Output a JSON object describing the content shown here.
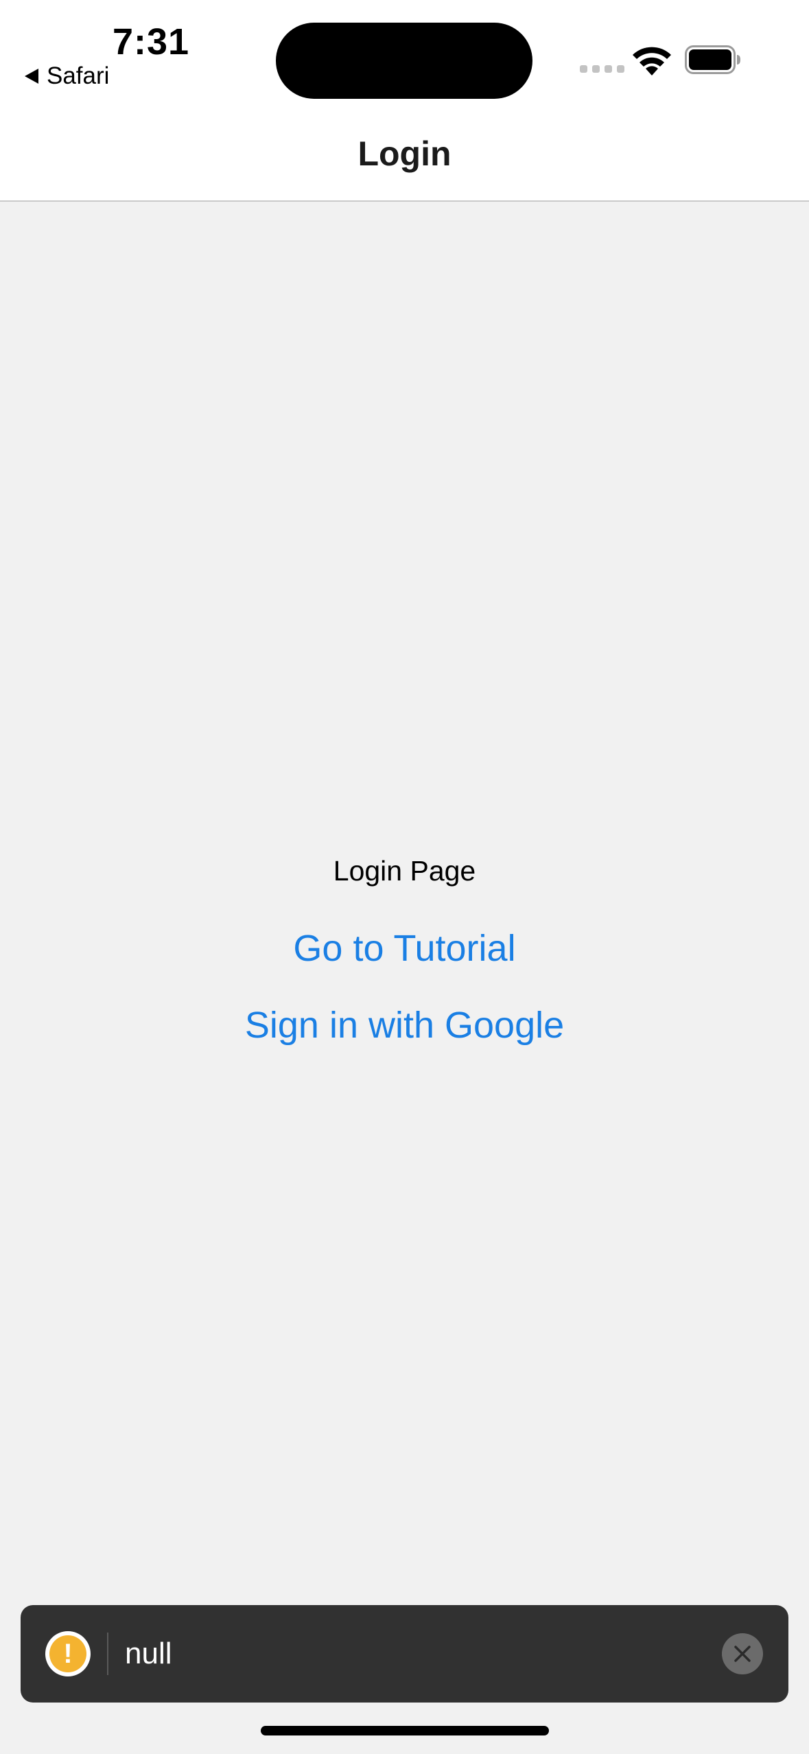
{
  "status_bar": {
    "time": "7:31",
    "back_app": "Safari",
    "icons": [
      "back-triangle-icon",
      "cellular-signal-icon",
      "wifi-icon",
      "battery-icon"
    ]
  },
  "nav": {
    "title": "Login"
  },
  "content": {
    "page_label": "Login Page",
    "tutorial_link": "Go to Tutorial",
    "google_link": "Sign in with Google"
  },
  "toast": {
    "message": "null",
    "icon": "warning-icon",
    "warning_glyph": "!",
    "close_icon": "close-icon"
  },
  "colors": {
    "link": "#1a7fe4",
    "toast_bg": "#313131",
    "warning": "#f4b330",
    "background": "#f1f1f1"
  }
}
